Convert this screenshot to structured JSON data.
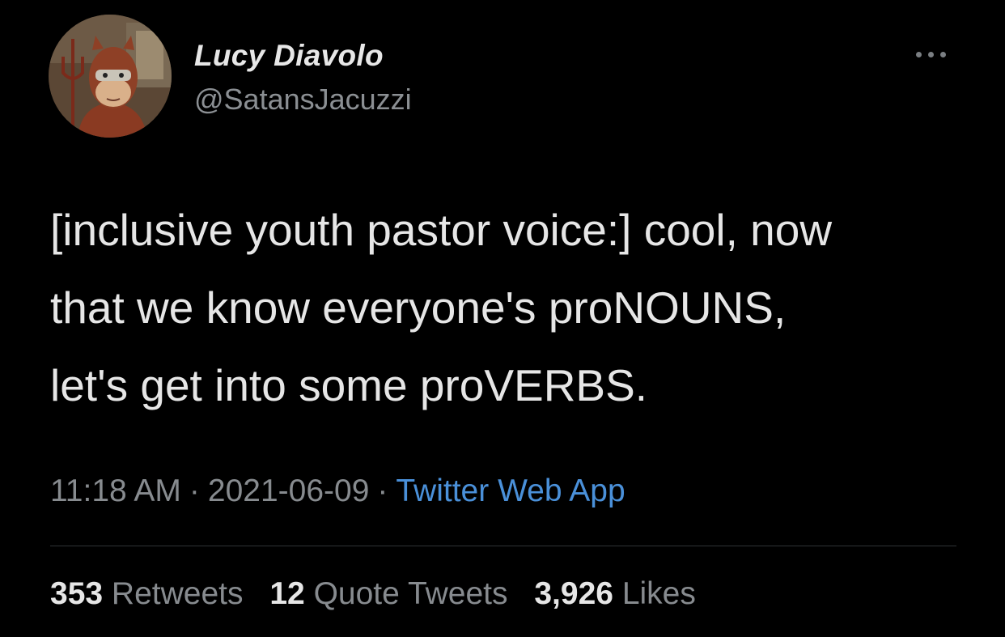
{
  "user": {
    "display_name": "Lucy Diavolo",
    "handle": "@SatansJacuzzi",
    "avatar_icon": "devil-costume-avatar"
  },
  "more_icon": "more-options-icon",
  "tweet": {
    "lines": [
      "[inclusive youth pastor voice:] cool, now",
      "that we know everyone's proNOUNS,",
      "let's get into some proVERBS."
    ]
  },
  "meta": {
    "time": "11:18 AM",
    "separator": "·",
    "date": "2021-06-09",
    "source": "Twitter Web App"
  },
  "stats": {
    "retweets_count": "353",
    "retweets_label": "Retweets",
    "quotes_count": "12",
    "quotes_label": "Quote Tweets",
    "likes_count": "3,926",
    "likes_label": "Likes"
  },
  "colors": {
    "background": "#000000",
    "link": "#4a90d9",
    "secondary_text": "#878b8f",
    "primary_text": "#e6e6e6"
  }
}
